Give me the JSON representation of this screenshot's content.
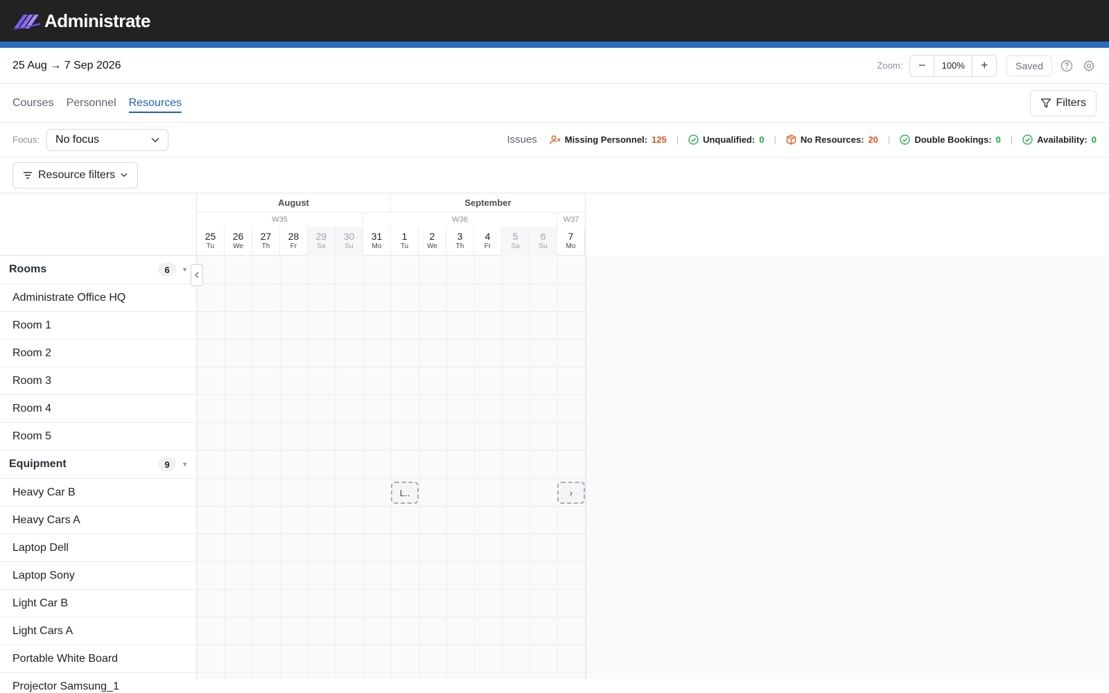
{
  "app": {
    "title": "Administrate"
  },
  "toolbar": {
    "date_range": "25 Aug → 7 Sep 2026",
    "zoom_label": "Zoom:",
    "zoom_minus": "−",
    "zoom_value": "100%",
    "zoom_plus": "+",
    "saved_label": "Saved"
  },
  "tabs": [
    {
      "label": "Courses",
      "active": false
    },
    {
      "label": "Personnel",
      "active": false
    },
    {
      "label": "Resources",
      "active": true
    }
  ],
  "filters_label": "Filters",
  "focus": {
    "label": "Focus:",
    "value": "No focus"
  },
  "issues": {
    "title": "Issues",
    "items": [
      {
        "label": "Missing Personnel:",
        "count": "125",
        "status": "error",
        "icon": "person-x-icon"
      },
      {
        "label": "Unqualified:",
        "count": "0",
        "status": "ok",
        "icon": "check-circle-icon"
      },
      {
        "label": "No Resources:",
        "count": "20",
        "status": "error",
        "icon": "box-icon"
      },
      {
        "label": "Double Bookings:",
        "count": "0",
        "status": "ok",
        "icon": "check-circle-icon"
      },
      {
        "label": "Availability:",
        "count": "0",
        "status": "ok",
        "icon": "check-circle-icon"
      }
    ]
  },
  "resource_filters_label": "Resource filters",
  "calendar": {
    "months": [
      {
        "name": "August",
        "days": 7
      },
      {
        "name": "September",
        "days": 7
      }
    ],
    "weeks": [
      {
        "name": "W35",
        "days": 6
      },
      {
        "name": "W36",
        "days": 7
      },
      {
        "name": "W37",
        "days": 1
      }
    ],
    "days": [
      {
        "num": "25",
        "dow": "Tu",
        "weekend": false
      },
      {
        "num": "26",
        "dow": "We",
        "weekend": false
      },
      {
        "num": "27",
        "dow": "Th",
        "weekend": false
      },
      {
        "num": "28",
        "dow": "Fr",
        "weekend": false
      },
      {
        "num": "29",
        "dow": "Sa",
        "weekend": true
      },
      {
        "num": "30",
        "dow": "Su",
        "weekend": true
      },
      {
        "num": "31",
        "dow": "Mo",
        "weekend": false
      },
      {
        "num": "1",
        "dow": "Tu",
        "weekend": false
      },
      {
        "num": "2",
        "dow": "We",
        "weekend": false
      },
      {
        "num": "3",
        "dow": "Th",
        "weekend": false
      },
      {
        "num": "4",
        "dow": "Fr",
        "weekend": false
      },
      {
        "num": "5",
        "dow": "Sa",
        "weekend": true
      },
      {
        "num": "6",
        "dow": "Su",
        "weekend": true
      },
      {
        "num": "7",
        "dow": "Mo",
        "weekend": false
      }
    ]
  },
  "groups": [
    {
      "name": "Rooms",
      "count": "6",
      "items": [
        "Administrate Office HQ",
        "Room 1",
        "Room 2",
        "Room 3",
        "Room 4",
        "Room 5"
      ]
    },
    {
      "name": "Equipment",
      "count": "9",
      "items": [
        "Heavy Car B",
        "Heavy Cars A",
        "Laptop Dell",
        "Laptop Sony",
        "Light Car B",
        "Light Cars A",
        "Portable White Board",
        "Projector Samsung_1"
      ]
    }
  ],
  "bookings": [
    {
      "resource": "Heavy Car B",
      "day_index": 7,
      "label": "L.."
    },
    {
      "resource": "Heavy Car B",
      "day_index": 13,
      "label": "›"
    }
  ],
  "colors": {
    "accent": "#1f5fbf",
    "topbar": "#222222",
    "strip": "#2c6bbf",
    "error": "#e0541d",
    "ok": "#1ea44a"
  }
}
